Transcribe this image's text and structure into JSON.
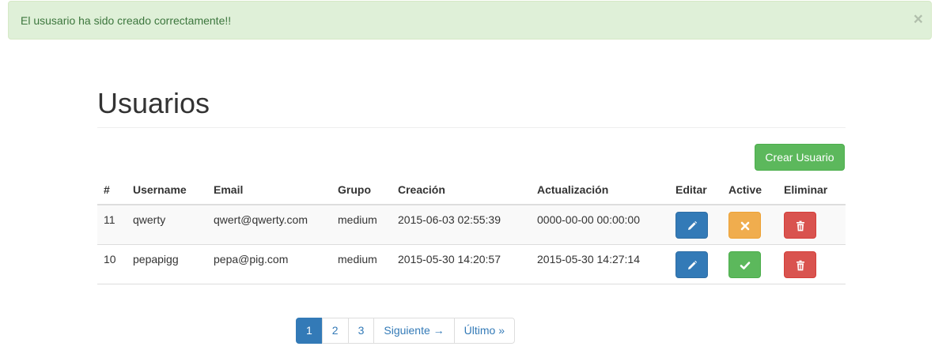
{
  "alert": {
    "message": "El ususario ha sido creado correctamente!!",
    "close_symbol": "×"
  },
  "page": {
    "title": "Usuarios"
  },
  "toolbar": {
    "create_label": "Crear Usuario"
  },
  "table": {
    "headers": [
      "#",
      "Username",
      "Email",
      "Grupo",
      "Creación",
      "Actualización",
      "Editar",
      "Active",
      "Eliminar"
    ],
    "rows": [
      {
        "id": "11",
        "username": "qwerty",
        "email": "qwert@qwerty.com",
        "grupo": "medium",
        "creacion": "2015-06-03 02:55:39",
        "actualizacion": "0000-00-00 00:00:00",
        "active_state": "inactive",
        "active_icon": "times-icon"
      },
      {
        "id": "10",
        "username": "pepapigg",
        "email": "pepa@pig.com",
        "grupo": "medium",
        "creacion": "2015-05-30 14:20:57",
        "actualizacion": "2015-05-30 14:27:14",
        "active_state": "active",
        "active_icon": "check-icon"
      }
    ]
  },
  "pagination": {
    "pages": [
      "1",
      "2",
      "3"
    ],
    "current": "1",
    "next_label": "Siguiente →",
    "last_label": "Último »"
  },
  "colors": {
    "primary": "#337ab7",
    "success": "#5cb85c",
    "warning": "#f0ad4e",
    "danger": "#d9534f",
    "alert_bg": "#dff0d8",
    "alert_text": "#3c763d"
  }
}
